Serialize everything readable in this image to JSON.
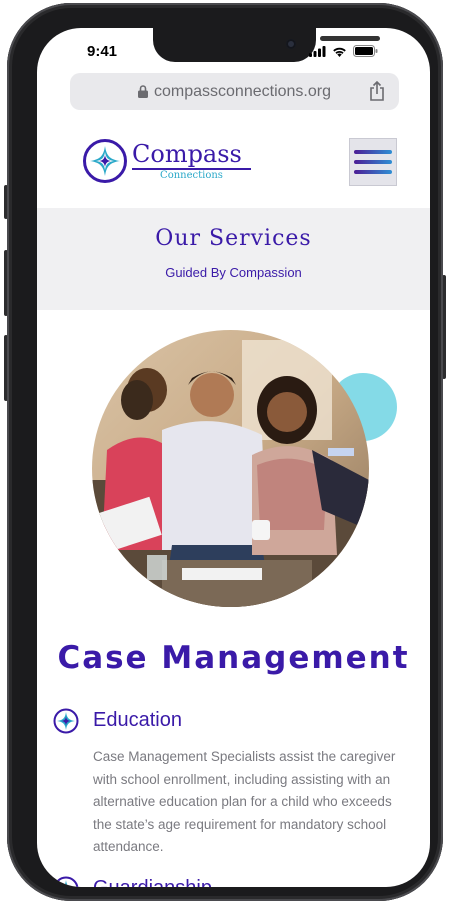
{
  "status_bar": {
    "time": "9:41"
  },
  "browser": {
    "url": "compassconnections.org"
  },
  "header": {
    "logo": {
      "title": "Compass",
      "subtitle": "Connections"
    },
    "menu_icon": "hamburger-icon"
  },
  "hero": {
    "title": "Our Services",
    "subtitle": "Guided By Compassion"
  },
  "photo": {
    "description_icon": "family-photo"
  },
  "section": {
    "title": "Case Management",
    "items": [
      {
        "icon": "compass-icon",
        "heading": "Education",
        "body": "Case Management Specialists assist the caregiver with school enrollment, including assisting with an alternative education plan for a child who exceeds the state’s age requirement for mandatory school attendance."
      },
      {
        "icon": "compass-icon",
        "heading": "Guardianship"
      }
    ]
  },
  "colors": {
    "brand_purple": "#3a1aa8",
    "brand_teal": "#2ba9c9",
    "accent_teal": "#7dd8e6"
  }
}
